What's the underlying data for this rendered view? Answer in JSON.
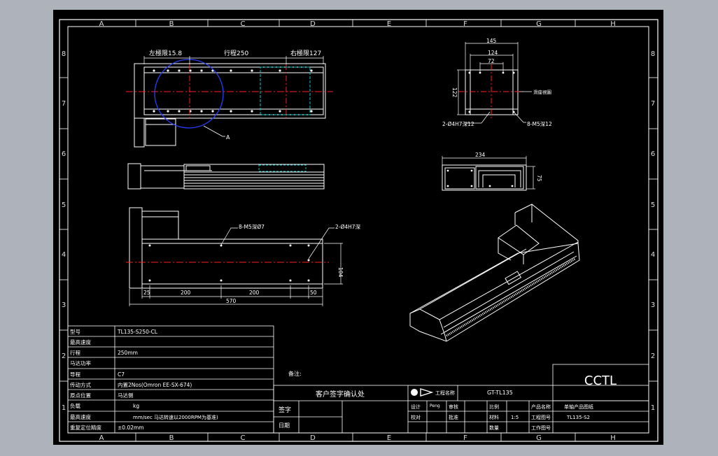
{
  "grid": {
    "cols": [
      "A",
      "B",
      "C",
      "D",
      "E",
      "F",
      "G",
      "H"
    ],
    "rows": [
      "8",
      "7",
      "6",
      "5",
      "4",
      "3",
      "2",
      "1"
    ]
  },
  "dims": {
    "left_limit": "左極限15.8",
    "stroke": "行程250",
    "right_limit": "右極限127",
    "circle_label": "A",
    "side_holes": "8-M5深Ø7",
    "side_pin": "2-Ø4H7深",
    "d25": "25",
    "d200a": "200",
    "d200b": "200",
    "d50": "50",
    "d104": "104",
    "d570": "570",
    "top_145": "145",
    "top_124": "124",
    "top_72": "72",
    "top_122": "122",
    "top_pin": "2-Ø4H7深12",
    "top_holes": "8-M5深12",
    "top_note": "滑座視圖",
    "end_234": "234",
    "end_75": "75"
  },
  "spec_table": {
    "rows": [
      {
        "label": "型号",
        "value": "TL135-S250-CL"
      },
      {
        "label": "最高速度",
        "value": ""
      },
      {
        "label": "行程",
        "value": "250mm"
      },
      {
        "label": "马达功率",
        "value": ""
      },
      {
        "label": "导程",
        "value": "C7"
      },
      {
        "label": "传动方式",
        "value": "内置2Nos(Omron EE-SX-674)"
      },
      {
        "label": "原点位置",
        "value": "马达侧"
      },
      {
        "label": "负载",
        "value": "kg"
      },
      {
        "label": "最高速度",
        "value": "mm/sec 马达转速以2000RPM为基准)"
      },
      {
        "label": "重复定位精度",
        "value": "±0.02mm"
      }
    ]
  },
  "title_block": {
    "note_label": "备注:",
    "customer_confirm": "客户签字确认处",
    "sign_label": "签字",
    "date_label": "日期",
    "drawing_no_label": "工程名称",
    "drawing_no": "GT-TL135",
    "company": "CCTL",
    "designer_label": "设计",
    "designer_name": "Peng",
    "audit_label": "审核",
    "check_label": "校对",
    "approve_label": "批准",
    "ratio_label": "比例",
    "ratio_value": "1:5",
    "qty_label": "数量",
    "material_label": "材料",
    "product_name_label": "产品名称",
    "product_name": "单轴产品图纸",
    "drawing_code_label": "工程图号",
    "drawing_code": "TL135-S2",
    "sheet_label": "工作图号"
  }
}
